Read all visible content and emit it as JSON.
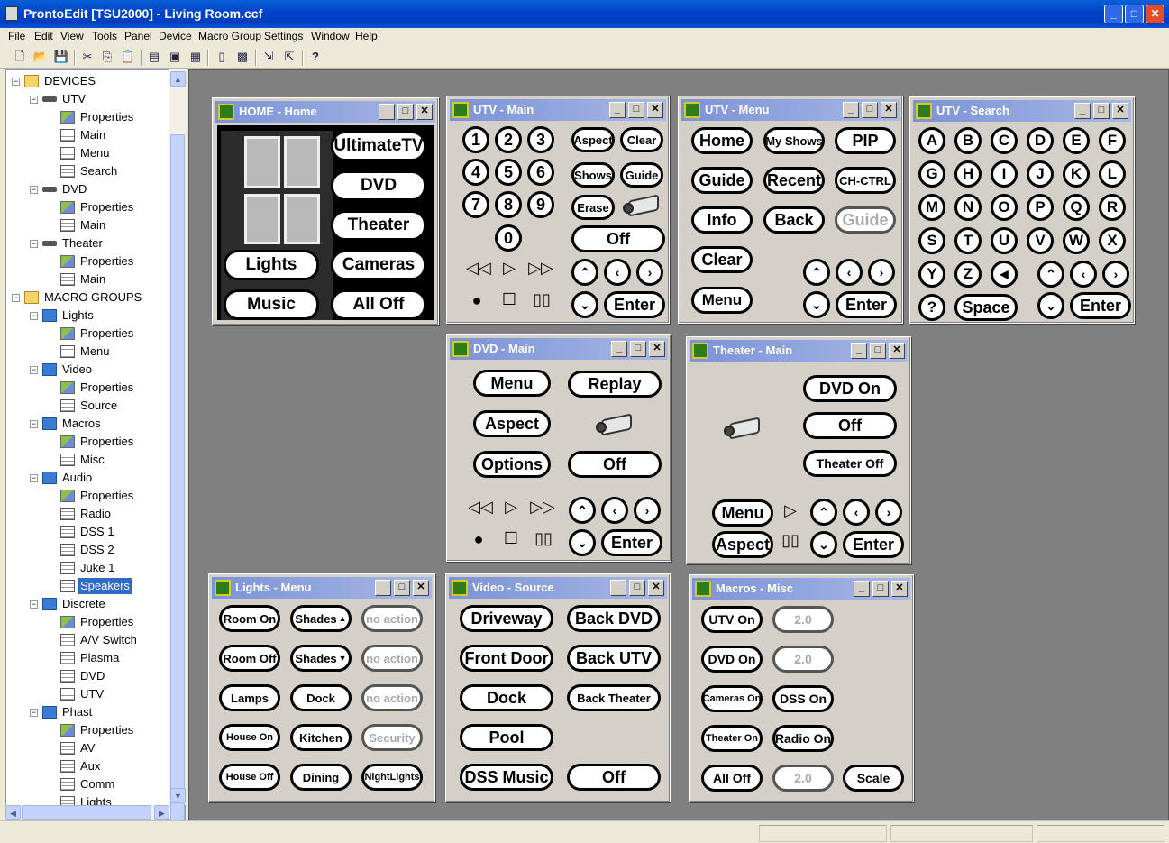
{
  "app": {
    "title": "ProntoEdit [TSU2000] - Living Room.ccf"
  },
  "menu": [
    "File",
    "Edit",
    "View",
    "Tools",
    "Panel",
    "Device",
    "Macro Group",
    "Settings",
    "Window",
    "Help"
  ],
  "toolbar": {
    "icons": [
      "new-icon",
      "open-icon",
      "save-icon",
      "cut-icon",
      "copy-icon",
      "paste-icon",
      "properties-icon",
      "export-icon",
      "import-icon",
      "device-icon",
      "macro-icon",
      "download-icon",
      "upload-icon",
      "help-icon"
    ]
  },
  "tree": [
    {
      "label": "DEVICES",
      "icon": "folder"
    },
    {
      "label": "UTV",
      "icon": "device"
    },
    {
      "label": "Properties",
      "icon": "properties"
    },
    {
      "label": "Main",
      "icon": "panel"
    },
    {
      "label": "Menu",
      "icon": "panel"
    },
    {
      "label": "Search",
      "icon": "panel"
    },
    {
      "label": "DVD",
      "icon": "device"
    },
    {
      "label": "Properties",
      "icon": "properties"
    },
    {
      "label": "Main",
      "icon": "panel"
    },
    {
      "label": "Theater",
      "icon": "device"
    },
    {
      "label": "Properties",
      "icon": "properties"
    },
    {
      "label": "Main",
      "icon": "panel"
    },
    {
      "label": "MACRO GROUPS",
      "icon": "folder"
    },
    {
      "label": "Lights",
      "icon": "macro"
    },
    {
      "label": "Properties",
      "icon": "properties"
    },
    {
      "label": "Menu",
      "icon": "panel"
    },
    {
      "label": "Video",
      "icon": "macro"
    },
    {
      "label": "Properties",
      "icon": "properties"
    },
    {
      "label": "Source",
      "icon": "panel"
    },
    {
      "label": "Macros",
      "icon": "macro"
    },
    {
      "label": "Properties",
      "icon": "properties"
    },
    {
      "label": "Misc",
      "icon": "panel"
    },
    {
      "label": "Audio",
      "icon": "macro"
    },
    {
      "label": "Properties",
      "icon": "properties"
    },
    {
      "label": "Radio",
      "icon": "panel"
    },
    {
      "label": "DSS 1",
      "icon": "panel"
    },
    {
      "label": "DSS 2",
      "icon": "panel"
    },
    {
      "label": "Juke 1",
      "icon": "panel"
    },
    {
      "label": "Speakers",
      "icon": "panel",
      "selected": true
    },
    {
      "label": "Discrete",
      "icon": "macro"
    },
    {
      "label": "Properties",
      "icon": "properties"
    },
    {
      "label": "A/V Switch",
      "icon": "panel"
    },
    {
      "label": "Plasma",
      "icon": "panel"
    },
    {
      "label": "DVD",
      "icon": "panel"
    },
    {
      "label": "UTV",
      "icon": "panel"
    },
    {
      "label": "Phast",
      "icon": "macro"
    },
    {
      "label": "Properties",
      "icon": "properties"
    },
    {
      "label": "AV",
      "icon": "panel"
    },
    {
      "label": "Aux",
      "icon": "panel"
    },
    {
      "label": "Comm",
      "icon": "panel"
    },
    {
      "label": "Lights",
      "icon": "panel"
    }
  ],
  "windows": {
    "home": {
      "title": "HOME - Home",
      "buttons": [
        "UltimateTV",
        "DVD",
        "Theater",
        "Lights",
        "Cameras",
        "Music",
        "All Off"
      ]
    },
    "utv_main": {
      "title": "UTV - Main",
      "digits": [
        "1",
        "2",
        "3",
        "4",
        "5",
        "6",
        "7",
        "8",
        "9",
        "0"
      ],
      "buttons": [
        "Aspect",
        "Clear",
        "Shows",
        "Guide",
        "Erase",
        "Off",
        "Enter"
      ]
    },
    "utv_menu": {
      "title": "UTV - Menu",
      "buttons": [
        "Home",
        "My Shows",
        "PIP",
        "Guide",
        "Recent",
        "CH-CTRL",
        "Info",
        "Back",
        "Guide",
        "Clear",
        "Menu",
        "Enter"
      ]
    },
    "utv_search": {
      "title": "UTV - Search",
      "letters": [
        "A",
        "B",
        "C",
        "D",
        "E",
        "F",
        "G",
        "H",
        "I",
        "J",
        "K",
        "L",
        "M",
        "N",
        "O",
        "P",
        "Q",
        "R",
        "S",
        "T",
        "U",
        "V",
        "W",
        "X",
        "Y",
        "Z"
      ],
      "buttons": [
        "?",
        "Space",
        "Enter"
      ]
    },
    "dvd_main": {
      "title": "DVD - Main",
      "buttons": [
        "Menu",
        "Replay",
        "Aspect",
        "Options",
        "Off",
        "Enter"
      ]
    },
    "theater_main": {
      "title": "Theater - Main",
      "buttons": [
        "DVD On",
        "Off",
        "Theater Off",
        "Menu",
        "Aspect",
        "Enter"
      ]
    },
    "lights_menu": {
      "title": "Lights - Menu",
      "buttons": [
        "Room On",
        "Shades",
        "no action",
        "Room Off",
        "Shades",
        "no action",
        "Lamps",
        "Dock",
        "no action",
        "House On",
        "Kitchen",
        "Security",
        "House Off",
        "Dining",
        "NightLights"
      ]
    },
    "video_source": {
      "title": "Video - Source",
      "buttons": [
        "Driveway",
        "Back DVD",
        "Front Door",
        "Back UTV",
        "Dock",
        "Back Theater",
        "Pool",
        "DSS Music",
        "Off"
      ]
    },
    "macros_misc": {
      "title": "Macros - Misc",
      "buttons": [
        "UTV On",
        "2.0",
        "DVD On",
        "2.0",
        "Cameras On",
        "DSS On",
        "Theater On",
        "Radio On",
        "All Off",
        "2.0",
        "Scale"
      ]
    }
  },
  "colors": {
    "titlebar": "#0043c8",
    "mdi_background": "#808080",
    "panel_title": "#7b92d6",
    "selection": "#316ac5"
  }
}
